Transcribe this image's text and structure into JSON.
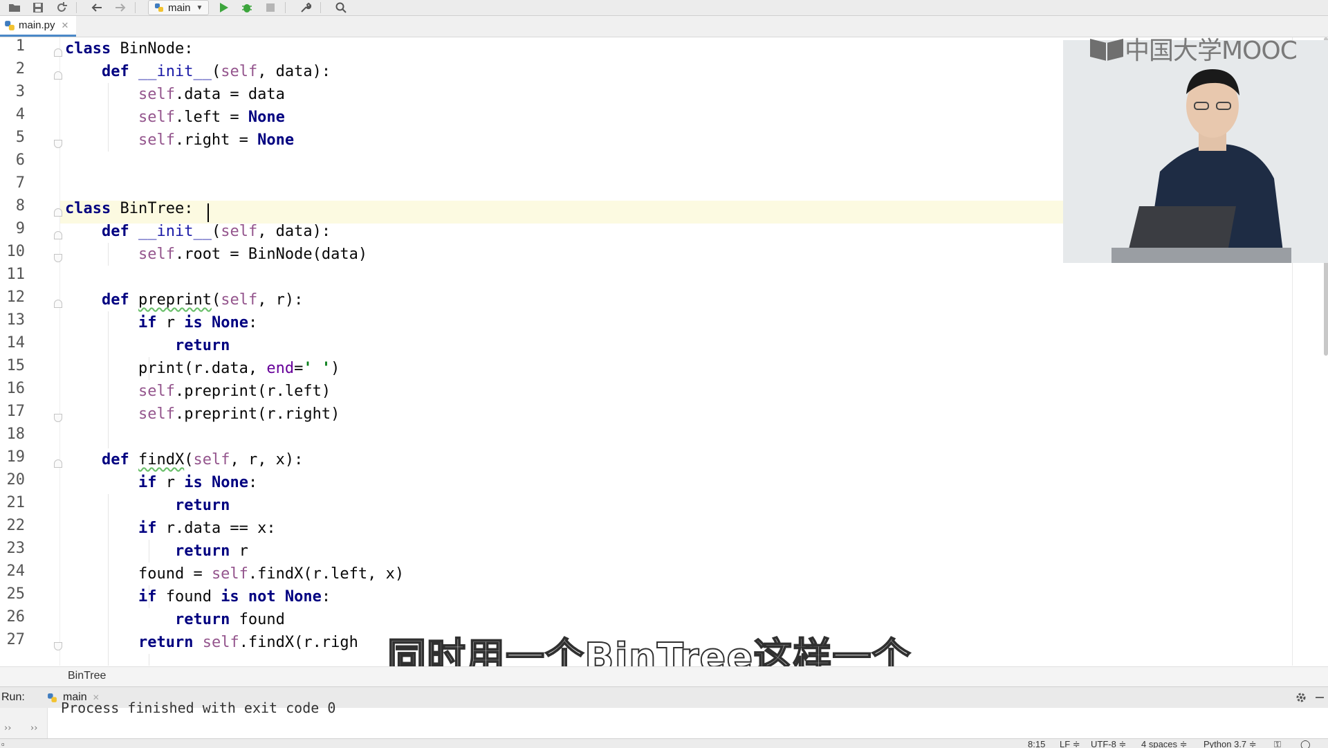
{
  "toolbar": {
    "items": [
      {
        "name": "open-icon"
      },
      {
        "name": "save-icon"
      },
      {
        "name": "sync-icon"
      },
      {
        "name": "back-icon"
      },
      {
        "name": "forward-icon"
      }
    ],
    "run_config": "main",
    "actions": [
      {
        "name": "run-icon",
        "color": "#3ca53c"
      },
      {
        "name": "debug-icon",
        "color": "#3ca53c"
      },
      {
        "name": "stop-icon",
        "color": "#b5b5b5"
      },
      {
        "name": "wrench-icon"
      },
      {
        "name": "search-icon"
      }
    ]
  },
  "editor_tab": {
    "filename": "main.py"
  },
  "line_numbers": [
    "1",
    "2",
    "3",
    "4",
    "5",
    "6",
    "7",
    "8",
    "9",
    "10",
    "11",
    "12",
    "13",
    "14",
    "15",
    "16",
    "17",
    "18",
    "19",
    "20",
    "21",
    "22",
    "23",
    "24",
    "25",
    "26",
    "27"
  ],
  "code": {
    "l1": {
      "kw": "class",
      "rest": " BinNode:"
    },
    "l2": {
      "kw": "def",
      "fn": "__init__",
      "open": "(",
      "self": "self",
      "rest": ", data):"
    },
    "l3": {
      "self": "self",
      "rest": ".data = data"
    },
    "l4": {
      "self": "self",
      "rest": ".left = ",
      "kw": "None"
    },
    "l5": {
      "self": "self",
      "rest": ".right = ",
      "kw": "None"
    },
    "l8": {
      "kw": "class",
      "rest": " BinTree:"
    },
    "l9": {
      "kw": "def",
      "fn": "__init__",
      "open": "(",
      "self": "self",
      "rest": ", data):"
    },
    "l10": {
      "self": "self",
      "rest": ".root = BinNode(data)"
    },
    "l12": {
      "kw": "def",
      "fn": "preprint",
      "open": "(",
      "self": "self",
      "rest": ", r):"
    },
    "l13": {
      "kw1": "if",
      "mid": " r ",
      "kw2": "is",
      "sp": " ",
      "kw3": "None",
      "rest": ":"
    },
    "l14": {
      "kw": "return"
    },
    "l15": {
      "pre": "print(r.data, ",
      "param": "end",
      "eq": "=",
      "str": "' '",
      "rest": ")"
    },
    "l16": {
      "self": "self",
      "rest": ".preprint(r.left)"
    },
    "l17": {
      "self": "self",
      "rest": ".preprint(r.right)"
    },
    "l19": {
      "kw": "def",
      "fn": "findX",
      "open": "(",
      "self": "self",
      "rest": ", r, x):"
    },
    "l20": {
      "kw1": "if",
      "mid": " r ",
      "kw2": "is",
      "sp": " ",
      "kw3": "None",
      "rest": ":"
    },
    "l21": {
      "kw": "return"
    },
    "l22": {
      "kw": "if",
      "rest": " r.data == x:"
    },
    "l23": {
      "kw": "return",
      "rest": " r"
    },
    "l24": {
      "pre": "found = ",
      "self": "self",
      "rest": ".findX(r.left, x)"
    },
    "l25": {
      "kw1": "if",
      "mid": " found ",
      "kw2": "is not",
      "sp": " ",
      "kw3": "None",
      "rest": ":"
    },
    "l26": {
      "kw": "return",
      "rest": " found"
    },
    "l27": {
      "kw": "return",
      "sp": " ",
      "self": "self",
      "rest": ".findX(r.righ"
    }
  },
  "overlay": {
    "logo_text": "中国大学MOOC",
    "subtitle": "同时用一个BinTree这样一个类"
  },
  "breadcrumb": "BinTree",
  "run_panel": {
    "label": "Run:",
    "tab": "main",
    "console_text": "Process finished with exit code 0"
  },
  "status_bar": {
    "position": "8:15",
    "line_sep": "LF ≑",
    "encoding": "UTF-8 ≑",
    "indent": "4 spaces ≑",
    "interpreter": "Python 3.7 ≑"
  },
  "colors": {
    "keyword": "#000080",
    "self": "#94558d",
    "string": "#067d17",
    "current_line": "#fcfae1"
  }
}
